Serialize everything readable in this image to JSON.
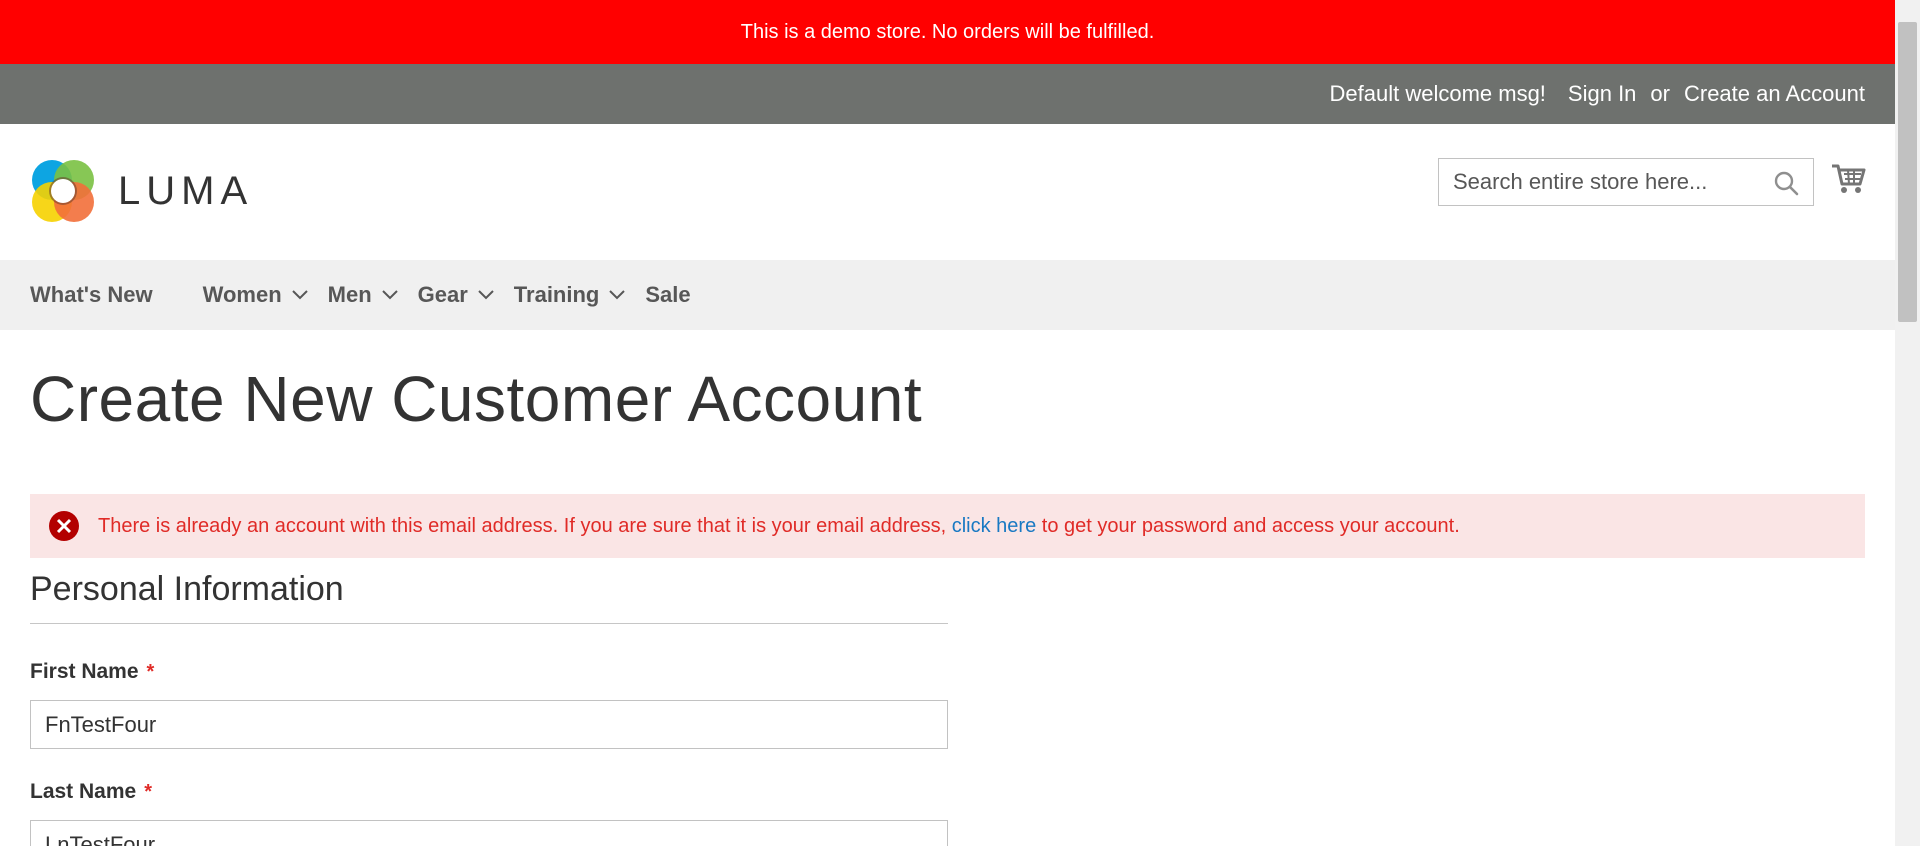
{
  "demo_notice": "This is a demo store. No orders will be fulfilled.",
  "header": {
    "welcome": "Default welcome msg!",
    "sign_in": "Sign In",
    "or": "or",
    "create_account": "Create an Account"
  },
  "logo": {
    "text": "LUMA"
  },
  "search": {
    "placeholder": "Search entire store here...",
    "value": ""
  },
  "nav": {
    "items": [
      "What's New",
      "Women",
      "Men",
      "Gear",
      "Training",
      "Sale"
    ]
  },
  "page_title": "Create New Customer Account",
  "error": {
    "text_before": "There is already an account with this email address. If you are sure that it is your email address, ",
    "link": "click here",
    "text_after": " to get your password and access your account."
  },
  "form": {
    "legend": "Personal Information",
    "first_name_label": "First Name",
    "first_name_value": "FnTestFour",
    "last_name_label": "Last Name",
    "last_name_value": "LnTestFour",
    "required_mark": "*"
  },
  "colors": {
    "banner": "#ff0000",
    "header_bar": "#6e716e",
    "error_bg": "#fae5e5",
    "error_text": "#e02b27",
    "link": "#1979c3"
  }
}
